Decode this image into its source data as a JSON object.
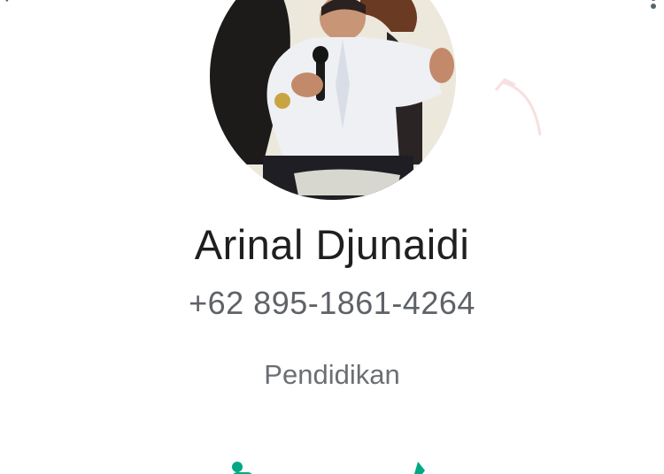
{
  "header": {
    "back_icon": "arrow-left-icon",
    "menu_icon": "more-vertical-icon"
  },
  "profile": {
    "name": "Arinal Djunaidi",
    "phone": "+62 895-1861-4264",
    "about": "Pendidikan"
  },
  "actions": [
    {
      "icon": "chat-icon"
    },
    {
      "icon": "call-icon"
    }
  ],
  "colors": {
    "accent": "#00a884",
    "icon_gray": "#54656f",
    "name_text": "#1f1f1f",
    "secondary_text": "#5f6368"
  }
}
